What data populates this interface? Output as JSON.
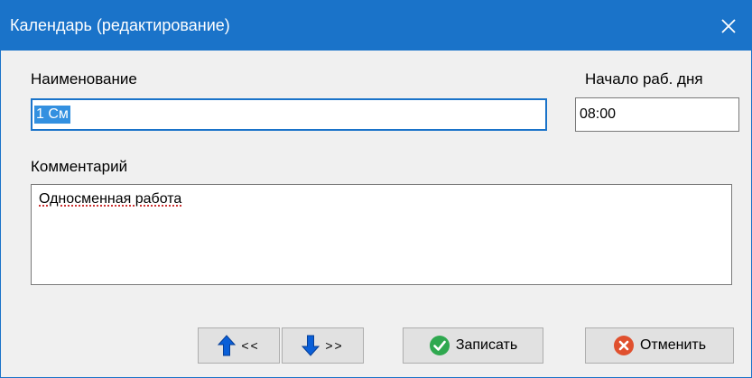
{
  "window": {
    "title": "Календарь (редактирование)",
    "close_label": "close"
  },
  "form": {
    "name_label": "Наименование",
    "name_value": "1 См",
    "start_label": "Начало раб. дня",
    "start_value": "08:00",
    "comment_label": "Комментарий",
    "comment_value": "Односменная работа"
  },
  "buttons": {
    "prev_arrows": "<<",
    "next_arrows": ">>",
    "save_label": "Записать",
    "cancel_label": "Отменить"
  },
  "colors": {
    "titlebar": "#1a73c9",
    "up_arrow": "#0a5fd8",
    "down_arrow": "#0a5fd8",
    "save_icon": "#2fa84f",
    "cancel_icon": "#e0502e"
  },
  "icons": {
    "close": "close-icon",
    "prev": "arrow-up-icon",
    "next": "arrow-down-icon",
    "save": "check-circle-icon",
    "cancel": "x-circle-icon"
  }
}
